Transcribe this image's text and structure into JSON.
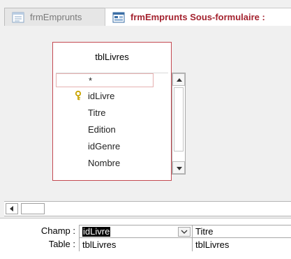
{
  "tabs": [
    {
      "label": "frmEmprunts",
      "active": false
    },
    {
      "label": "frmEmprunts Sous-formulaire :",
      "active": true
    }
  ],
  "table_box": {
    "title": "tblLivres",
    "fields": [
      "*",
      "idLivre",
      "Titre",
      "Edition",
      "idGenre",
      "Nombre"
    ],
    "primary_key_field": "idLivre"
  },
  "grid": {
    "row_labels": {
      "champ": "Champ :",
      "table": "Table :"
    },
    "columns": [
      {
        "champ": "idLivre",
        "table": "tblLivres"
      },
      {
        "champ": "Titre",
        "table": "tblLivres"
      }
    ]
  },
  "icons": [
    "form-icon",
    "subform-icon",
    "key-icon",
    "scroll-up-icon",
    "scroll-down-icon",
    "scroll-left-icon",
    "dropdown-arrow-icon"
  ],
  "colors": {
    "active_tab_text": "#a4232f",
    "table_border": "#c44a52",
    "key": "#c9a400"
  }
}
